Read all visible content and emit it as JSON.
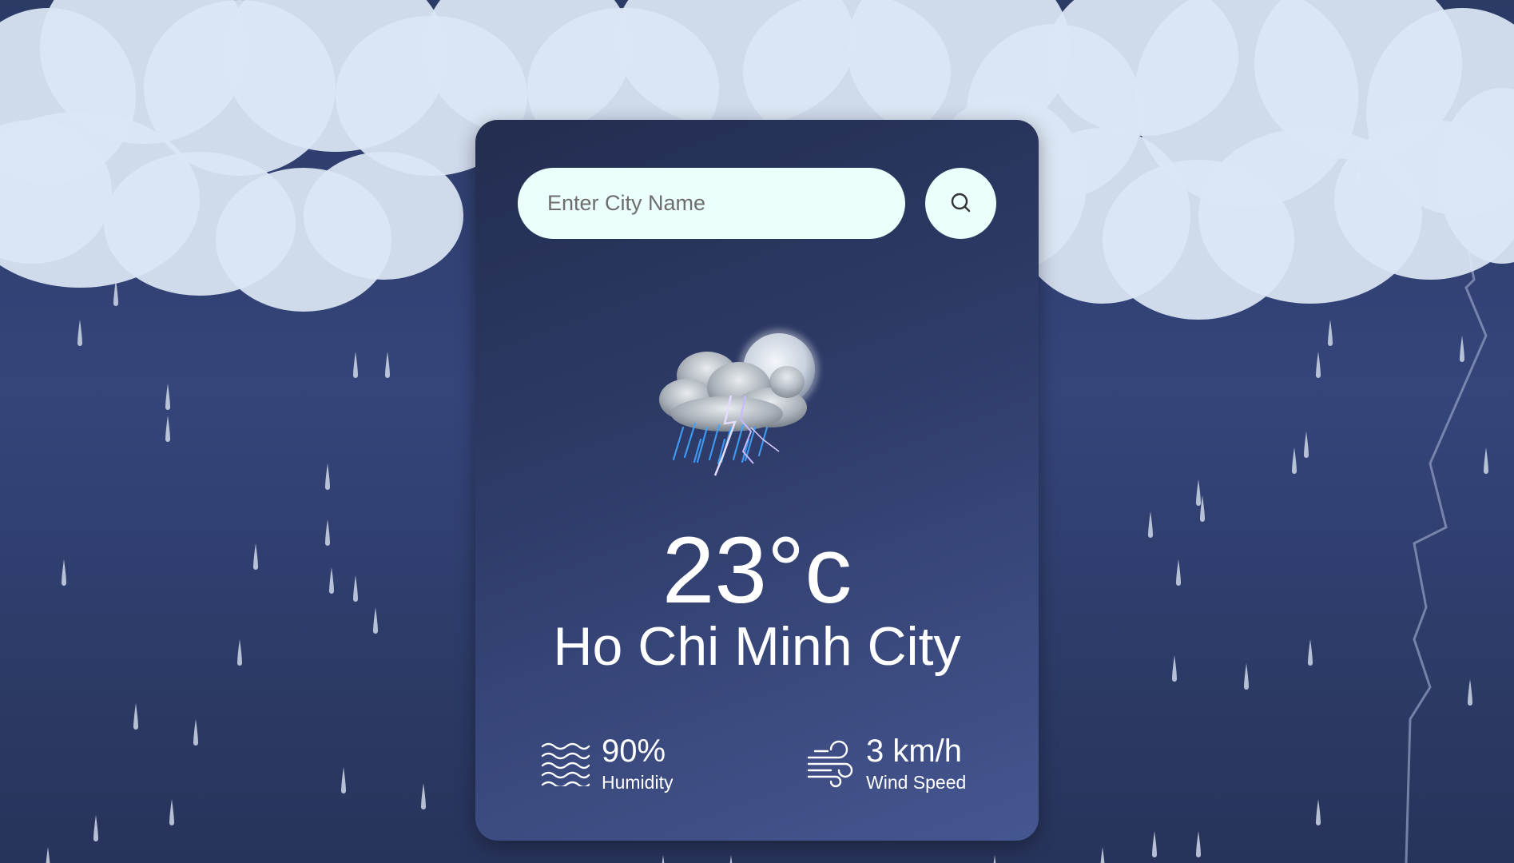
{
  "search": {
    "placeholder": "Enter City Name",
    "value": ""
  },
  "weather": {
    "condition_icon": "thunderstorm-night-icon",
    "temperature": "23°c",
    "city": "Ho Chi Minh City"
  },
  "details": {
    "humidity": {
      "value": "90%",
      "label": "Humidity",
      "icon": "humidity-waves-icon"
    },
    "wind": {
      "value": "3 km/h",
      "label": "Wind Speed",
      "icon": "wind-icon"
    }
  },
  "colors": {
    "background": "#2c3a66",
    "card_top": "#232d4f",
    "card_bottom": "#455690",
    "input_bg": "#ebfffb",
    "text": "#ffffff",
    "cloud": "#dce6f4",
    "rain": "#cfd8e8"
  }
}
